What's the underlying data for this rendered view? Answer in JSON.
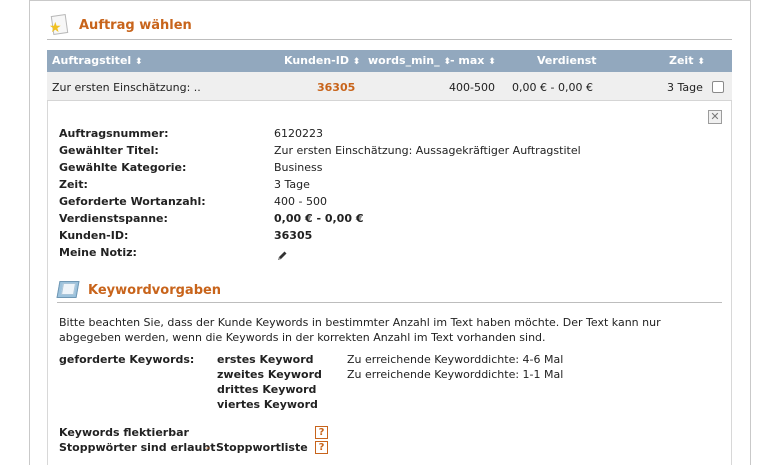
{
  "section_task": {
    "title": "Auftrag wählen",
    "icon": "task-icon"
  },
  "table": {
    "headers": {
      "title": "Auftragstitel",
      "customer_id": "Kunden-ID",
      "words_min": "words_min_",
      "words_max": "- max",
      "earnings": "Verdienst",
      "time": "Zeit"
    },
    "sort_glyph": "⬍",
    "row": {
      "title": "Zur ersten Einschätzung: ..",
      "customer_id": "36305",
      "words": "400-500",
      "earnings": "0,00 € - 0,00 €",
      "time": "3 Tage"
    }
  },
  "details": {
    "order_number_label": "Auftragsnummer:",
    "order_number": "6120223",
    "chosen_title_label": "Gewählter Titel:",
    "chosen_title": "Zur ersten Einschätzung: Aussagekräftiger Auftragstitel",
    "category_label": "Gewählte Kategorie:",
    "category": "Business",
    "time_label": "Zeit:",
    "time": "3 Tage",
    "wordcount_label": "Geforderte Wortanzahl:",
    "wordcount": "400 - 500",
    "earnings_label": "Verdienstspanne:",
    "earnings": "0,00 € - 0,00 €",
    "customer_label": "Kunden-ID:",
    "customer_id": "36305",
    "note_label": "Meine Notiz:",
    "close_glyph": "✕"
  },
  "section_keywords": {
    "title": "Keywordvorgaben",
    "icon": "keyword-book-icon",
    "intro": "Bitte beachten Sie, dass der Kunde Keywords in bestimmter Anzahl im Text haben möchte. Der Text kann nur abgegeben werden, wenn die Keywords in der korrekten Anzahl im Text vorhanden sind.",
    "required_label": "geforderte Keywords:",
    "keywords": [
      "erstes Keyword",
      "zweites Keyword",
      "drittes Keyword",
      "viertes Keyword"
    ],
    "densities": [
      "Zu erreichende Keyworddichte: 4-6 Mal",
      "Zu erreichende Keyworddichte: 1-1 Mal"
    ],
    "inflectable_label": "Keywords flektierbar",
    "stopwords_label": "Stoppwörter sind erlaubt",
    "stopwords_dash": "-",
    "stopwords_link": "Stoppwortliste",
    "help_glyph": "?"
  },
  "colors": {
    "accent": "#c8641b",
    "table_header": "#92a8be",
    "row_bg": "#efefef"
  }
}
